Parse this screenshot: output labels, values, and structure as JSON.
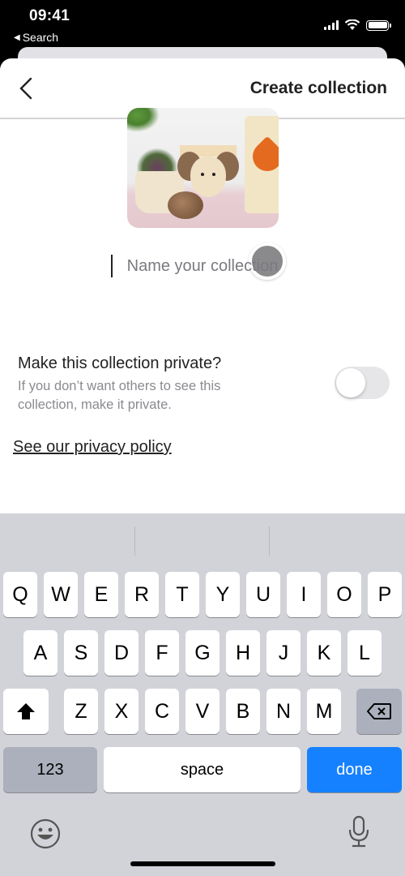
{
  "status_bar": {
    "time": "09:41",
    "back_label": "Search"
  },
  "nav": {
    "title": "Create collection",
    "back_icon": "chevron-left-icon"
  },
  "collection": {
    "name_placeholder": "Name your collection",
    "name_value": ""
  },
  "privacy": {
    "title": "Make this collection private?",
    "description": "If you don’t want others to see this collection, make it private.",
    "toggle_on": false,
    "policy_link": "See our privacy policy"
  },
  "keyboard": {
    "row1": [
      "Q",
      "W",
      "E",
      "R",
      "T",
      "Y",
      "U",
      "I",
      "O",
      "P"
    ],
    "row2": [
      "A",
      "S",
      "D",
      "F",
      "G",
      "H",
      "J",
      "K",
      "L"
    ],
    "row3": [
      "Z",
      "X",
      "C",
      "V",
      "B",
      "N",
      "M"
    ],
    "numbers_label": "123",
    "space_label": "space",
    "done_label": "done",
    "accent_color": "#1681ff"
  }
}
